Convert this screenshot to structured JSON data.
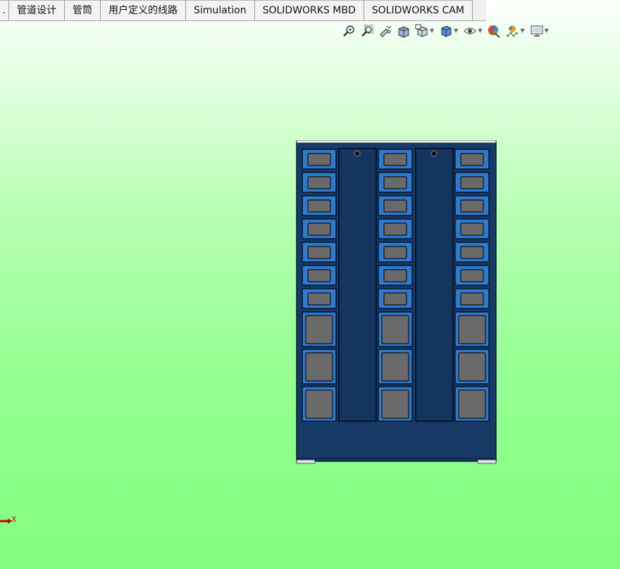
{
  "tabs": [
    {
      "label": ".",
      "clipped": true
    },
    {
      "label": "管道设计"
    },
    {
      "label": "管筒"
    },
    {
      "label": "用户定义的线路"
    },
    {
      "label": "Simulation"
    },
    {
      "label": "SOLIDWORKS MBD"
    },
    {
      "label": "SOLIDWORKS CAM"
    }
  ],
  "hud_icons": [
    "zoom-to-fit-icon",
    "zoom-to-area-icon",
    "previous-view-icon",
    "section-view-icon",
    "view-orientation-icon",
    "display-style-icon",
    "hide-show-items-icon",
    "edit-appearance-icon",
    "apply-scene-icon",
    "view-settings-icon"
  ],
  "colors": {
    "cabinet_body": "#173a67",
    "panel_blue": "#2c7ad2",
    "panel_window": "#6a6a6a",
    "triad_axis": "#cc0000"
  },
  "triad": {
    "axis_label": "X"
  }
}
